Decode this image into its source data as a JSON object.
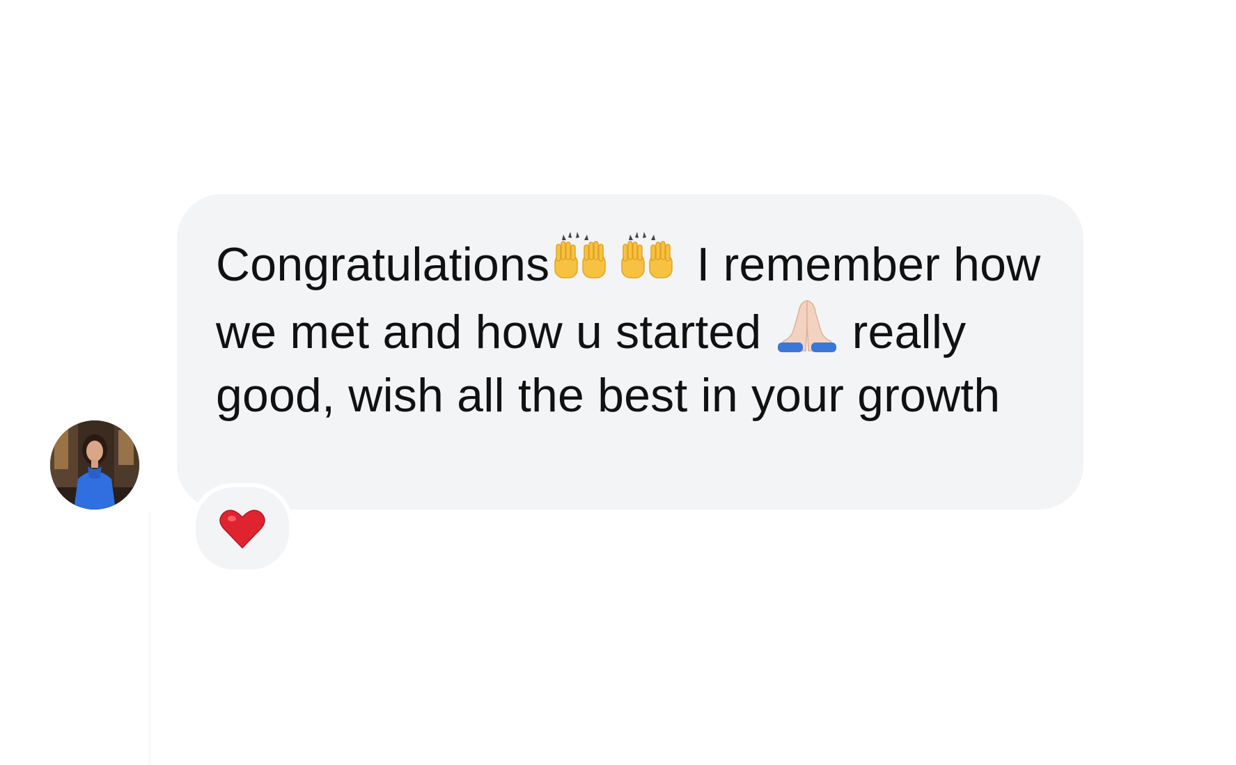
{
  "message": {
    "segments": [
      {
        "type": "text",
        "value": "Congratulations"
      },
      {
        "type": "emoji",
        "icon": "raising-hands-emoji"
      },
      {
        "type": "emoji",
        "icon": "raising-hands-emoji"
      },
      {
        "type": "text",
        "value": " I remember how we met and how u started "
      },
      {
        "type": "emoji",
        "icon": "folded-hands-emoji"
      },
      {
        "type": "text",
        "value": " really good, wish all the best in your growth"
      }
    ],
    "bubble_color": "#f3f4f6",
    "text_color": "#111111"
  },
  "avatar": {
    "icon": "profile-photo",
    "dress_color": "#2f6fe0"
  },
  "reaction": {
    "icon": "red-heart-emoji",
    "color": "#e0242f"
  }
}
